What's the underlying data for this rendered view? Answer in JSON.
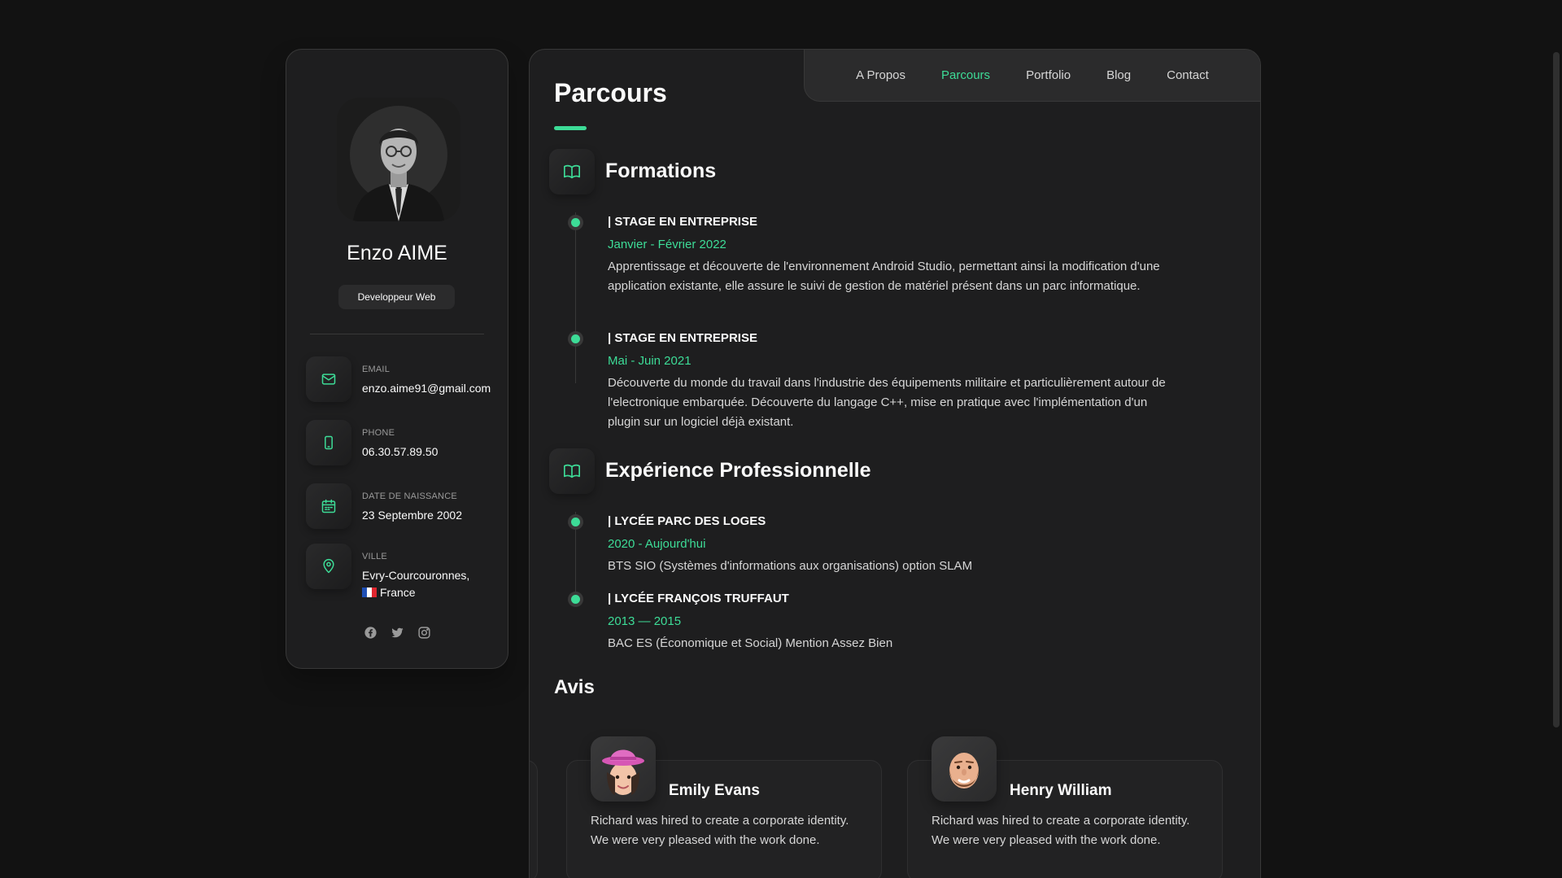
{
  "colors": {
    "accent": "#3ddc97",
    "background": "#121212",
    "card": "#1e1e1f",
    "border": "#383838"
  },
  "profile": {
    "name": "Enzo AIME",
    "title": "Developpeur Web",
    "contacts": [
      {
        "icon": "mail-icon",
        "label": "Email",
        "value": "enzo.aime91@gmail.com"
      },
      {
        "icon": "phone-icon",
        "label": "Phone",
        "value": "06.30.57.89.50"
      },
      {
        "icon": "calendar-icon",
        "label": "Date de naissance",
        "value": "23 Septembre 2002"
      },
      {
        "icon": "location-icon",
        "label": "Ville",
        "value": "Evry-Courcouronnes,",
        "value2": "France"
      }
    ],
    "socials": [
      "facebook-icon",
      "twitter-icon",
      "instagram-icon"
    ]
  },
  "nav": {
    "items": [
      "A Propos",
      "Parcours",
      "Portfolio",
      "Blog",
      "Contact"
    ],
    "active": "Parcours"
  },
  "page": {
    "title": "Parcours",
    "formations": {
      "title": "Formations",
      "icon": "book-icon",
      "items": [
        {
          "title": "| Stage en entreprise",
          "date": "Janvier - Février 2022",
          "text": "Apprentissage et découverte de l'environnement Android Studio, permettant ainsi la modification d'une application existante, elle assure le suivi de gestion de matériel présent dans un parc informatique."
        },
        {
          "title": "| Stage en entreprise",
          "date": "Mai - Juin 2021",
          "text": "Découverte du monde du travail dans l'industrie des équipements militaire et particulièrement autour de l'electronique embarquée. Découverte du langage C++, mise en pratique avec l'implémentation d'un plugin sur un logiciel déjà existant."
        }
      ]
    },
    "experience": {
      "title": "Expérience Professionnelle",
      "icon": "book-icon",
      "items": [
        {
          "title": "| Lycée parc des loges",
          "date": "2020 - Aujourd'hui",
          "text": "BTS SIO (Systèmes d'informations aux organisations) option SLAM"
        },
        {
          "title": "| Lycée François Truffaut",
          "date": "2013 — 2015",
          "text": "BAC ES (Économique et Social) Mention Assez Bien"
        }
      ]
    },
    "avis": {
      "title": "Avis",
      "reviews": [
        {
          "name": "Emily Evans",
          "text": "Richard was hired to create a corporate identity. We were very pleased with the work done."
        },
        {
          "name": "Henry William",
          "text": "Richard was hired to create a corporate identity. We were very pleased with the work done."
        }
      ]
    }
  }
}
